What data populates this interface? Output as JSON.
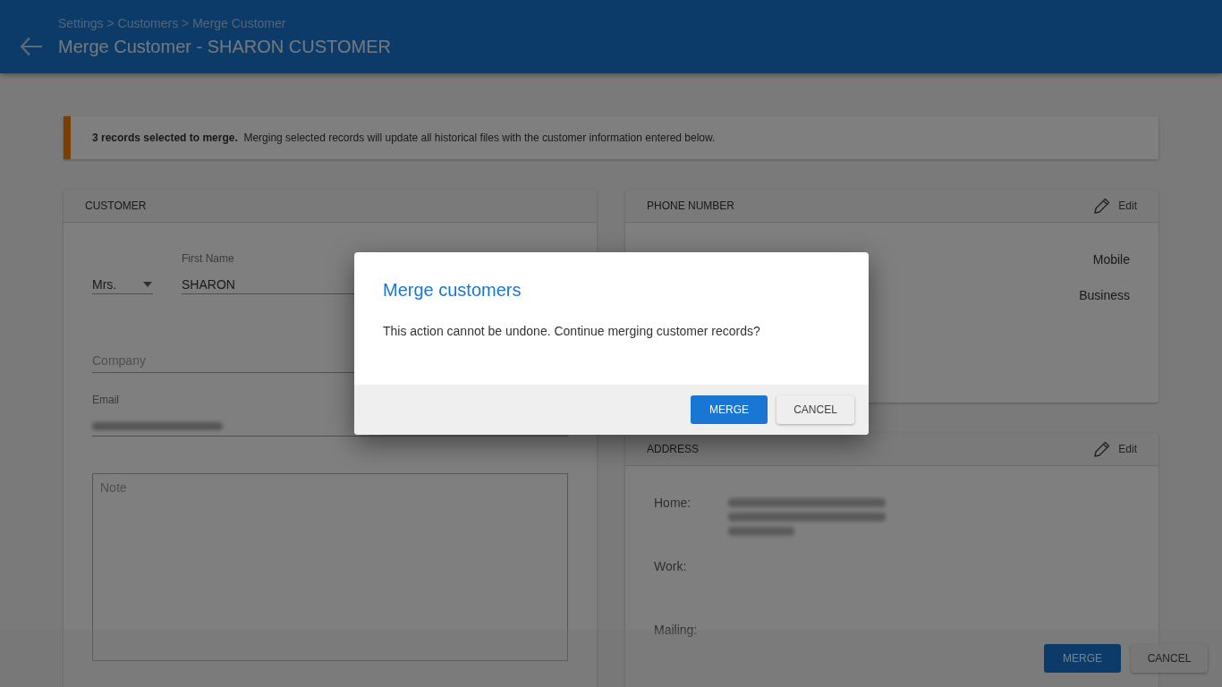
{
  "header": {
    "breadcrumb": "Settings > Customers > Merge Customer",
    "title": "Merge Customer - SHARON CUSTOMER"
  },
  "notice": {
    "text": "**3 records selected to merge.**  Merging selected records will update all historical files with the customer information entered below."
  },
  "customer_card": {
    "title": "CUSTOMER",
    "salutation": {
      "value": "Mrs."
    },
    "first_name": {
      "label": "First Name",
      "value": "SHARON"
    },
    "company": {
      "placeholder": "Company"
    },
    "email": {
      "label": "Email",
      "value_blurred": true
    },
    "note": {
      "placeholder": "Note"
    }
  },
  "phone_card": {
    "title": "PHONE NUMBER",
    "edit_label": "Edit",
    "types": [
      "Mobile",
      "Business"
    ]
  },
  "address_card": {
    "title": "ADDRESS",
    "edit_label": "Edit",
    "rows": [
      {
        "label": "Home:",
        "value_blurred": true
      },
      {
        "label": "Work:",
        "value_blurred": false
      },
      {
        "label": "Mailing:",
        "value_blurred": false
      }
    ]
  },
  "action_bar": {
    "buttons": [
      {
        "label": "MERGE",
        "kind": "confirm"
      },
      {
        "label": "CANCEL",
        "kind": "cancel"
      }
    ]
  },
  "dialog": {
    "title": "Merge customers",
    "message": "This action cannot be undone. Continue merging customer records?",
    "buttons": [
      {
        "label": "MERGE",
        "kind": "confirm"
      },
      {
        "label": "CANCEL",
        "kind": "cancel"
      }
    ]
  }
}
